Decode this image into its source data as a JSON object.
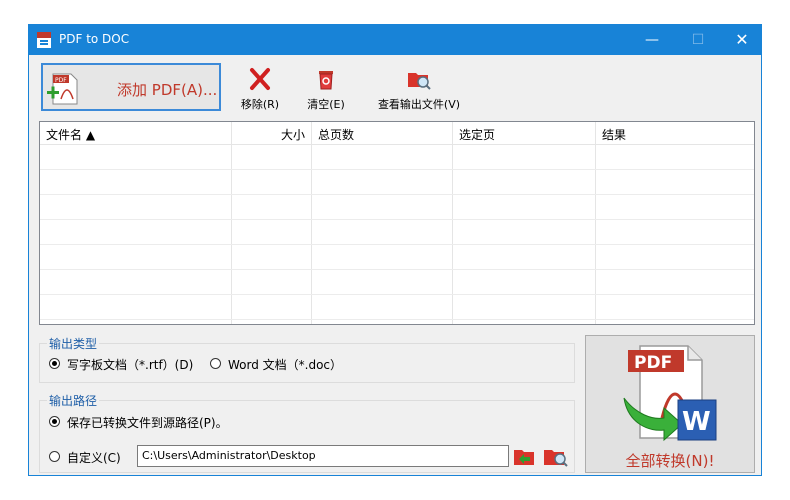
{
  "window": {
    "title": "PDF to DOC",
    "minimize": "—",
    "maximize": "☐",
    "close": "✕"
  },
  "toolbar": {
    "add_label": "添加 PDF(A)...",
    "remove_label": "移除(R)",
    "clear_label": "清空(E)",
    "view_output_label": "查看输出文件(V)"
  },
  "file_list": {
    "columns": [
      "文件名 ▲",
      "大小",
      "总页数",
      "选定页",
      "结果"
    ],
    "rows": []
  },
  "output_type": {
    "label": "输出类型",
    "option_rtf": "写字板文档（*.rtf）(D)",
    "option_doc": "Word 文档（*.doc）",
    "selected": "rtf"
  },
  "output_path": {
    "label": "输出路径",
    "option_source": "保存已转换文件到源路径(P)。",
    "option_custom": "自定义(C)",
    "custom_path": "C:\\Users\\Administrator\\Desktop",
    "selected": "source"
  },
  "convert": {
    "label": "全部转换(N)!"
  },
  "colors": {
    "titlebar": "#1883d7",
    "accent_red": "#c0392b",
    "group_label": "#1f5fa8"
  }
}
